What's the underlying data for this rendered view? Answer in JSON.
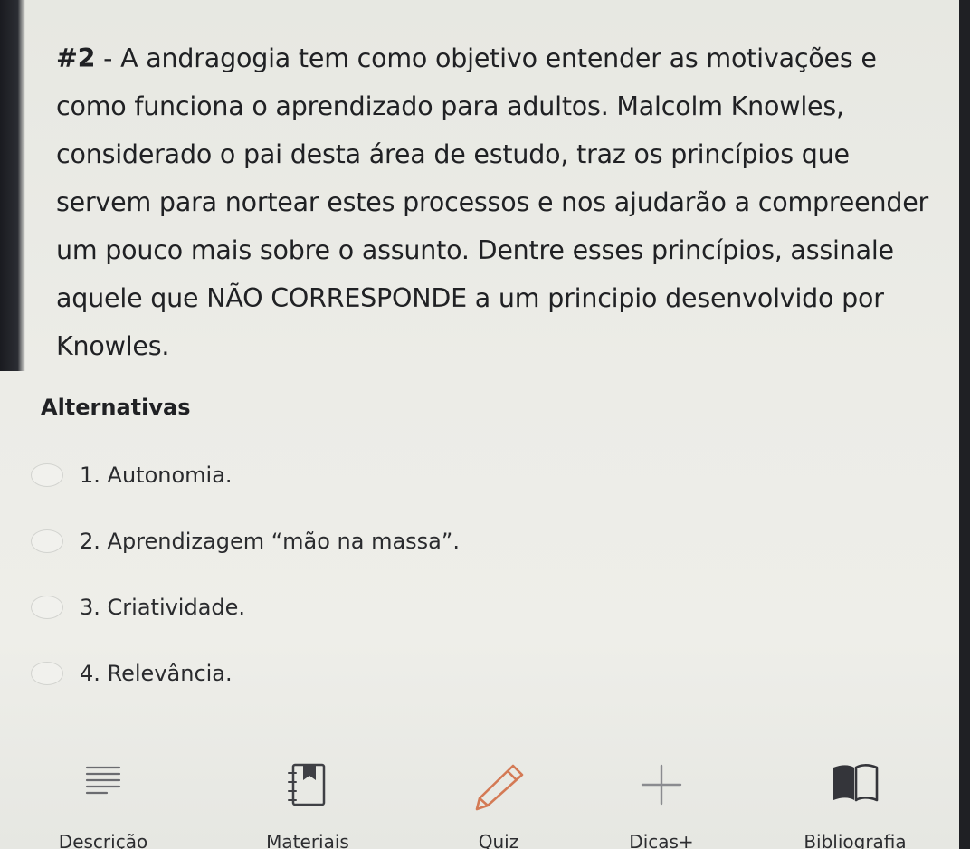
{
  "question": {
    "number": "#2",
    "text": " - A andragogia tem como objetivo entender as motivações e como funciona o aprendizado para adultos. Malcolm Knowles, considerado o pai desta área de estudo, traz os princípios que servem para nortear estes processos e nos ajudarão a compreender um pouco mais sobre o assunto. Dentre esses princípios, assinale aquele que NÃO CORRESPONDE a um principio desenvolvido por Knowles."
  },
  "alternatives": {
    "title": "Alternativas",
    "options": [
      {
        "label": "1. Autonomia."
      },
      {
        "label": "2. Aprendizagem “mão na massa”."
      },
      {
        "label": "3. Criatividade."
      },
      {
        "label": "4. Relevância."
      }
    ]
  },
  "nav": {
    "items": [
      {
        "label": "Descrição",
        "icon": "lines-icon"
      },
      {
        "label": "Materiais",
        "icon": "notebook-icon"
      },
      {
        "label": "Quiz",
        "icon": "pencil-icon"
      },
      {
        "label": "Dicas+",
        "icon": "plus-icon"
      },
      {
        "label": "Bibliografia",
        "icon": "book-icon"
      }
    ]
  }
}
